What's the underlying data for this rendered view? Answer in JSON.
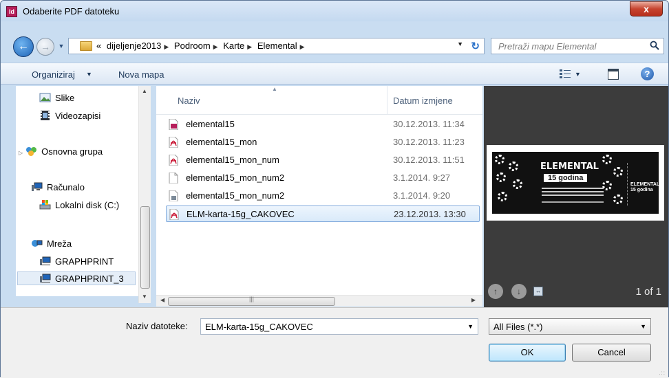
{
  "window": {
    "title": "Odaberite PDF datoteku",
    "app_icon_text": "Id",
    "close_label": "x"
  },
  "address": {
    "overflow": "«",
    "crumbs": [
      "dijeljenje2013",
      "Podroom",
      "Karte",
      "Elemental"
    ],
    "search_placeholder": "Pretraži mapu Elemental"
  },
  "toolbar": {
    "organize_label": "Organiziraj",
    "new_folder_label": "Nova mapa"
  },
  "nav": {
    "items": [
      {
        "label": "Slike",
        "icon": "pictures-icon"
      },
      {
        "label": "Videozapisi",
        "icon": "videos-icon"
      },
      {
        "label": "Osnovna grupa",
        "icon": "homegroup-icon"
      },
      {
        "label": "Računalo",
        "icon": "computer-icon"
      },
      {
        "label": "Lokalni disk (C:)",
        "icon": "local-disk-icon"
      },
      {
        "label": "Mreža",
        "icon": "network-icon"
      },
      {
        "label": "GRAPHPRINT",
        "icon": "network-computer-icon"
      },
      {
        "label": "GRAPHPRINT_3",
        "icon": "network-computer-icon"
      }
    ]
  },
  "files": {
    "col_name": "Naziv",
    "col_date": "Datum izmjene",
    "rows": [
      {
        "name": "elemental15",
        "date": "30.12.2013. 11:34",
        "icon": "indesign-file-icon"
      },
      {
        "name": "elemental15_mon",
        "date": "30.12.2013. 11:23",
        "icon": "pdf-file-icon"
      },
      {
        "name": "elemental15_mon_num",
        "date": "30.12.2013. 11:51",
        "icon": "pdf-file-icon"
      },
      {
        "name": "elemental15_mon_num2",
        "date": "3.1.2014. 9:27",
        "icon": "generic-file-icon"
      },
      {
        "name": "elemental15_mon_num2",
        "date": "3.1.2014. 9:20",
        "icon": "image-file-icon"
      },
      {
        "name": "ELM-karta-15g_CAKOVEC",
        "date": "23.12.2013. 13:30",
        "icon": "pdf-file-icon",
        "selected": true
      }
    ]
  },
  "preview": {
    "ticket_title": "ELEMENTAL",
    "ticket_sub": "15 godina",
    "stub_text": "ELEMENTAL 15 godina",
    "page_indicator": "1 of 1"
  },
  "footer": {
    "filename_label": "Naziv datoteke:",
    "filename_value": "ELM-karta-15g_CAKOVEC",
    "filetype_value": "All Files (*.*)",
    "ok_label": "OK",
    "cancel_label": "Cancel"
  }
}
